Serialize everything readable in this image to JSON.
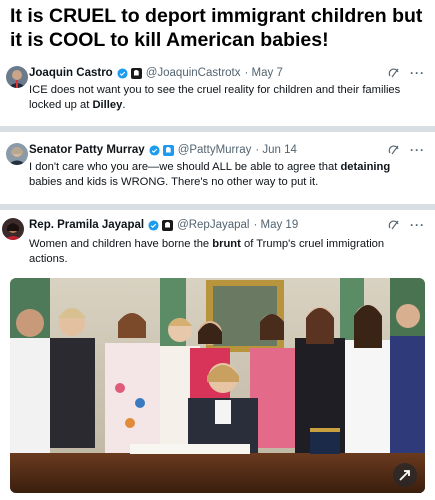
{
  "headline": {
    "line1": "It is CRUEL to deport immigrant children but",
    "line2": "it is COOL to kill American babies!"
  },
  "colors": {
    "verified": "#1d9bf0",
    "separator": "#d9dee2",
    "meta": "#536471"
  },
  "tweets": [
    {
      "name": "Joaquin Castro",
      "handle": "@JoaquinCastrotx",
      "date": "· May 7",
      "text_before": "ICE does not want you to see the cruel reality for children and their families locked up at ",
      "text_bold": "Dilley",
      "text_after": "."
    },
    {
      "name": "Senator Patty Murray",
      "handle": "@PattyMurray",
      "date": "· Jun 14",
      "text_before": "I don't care who you are—we should ALL be able to agree that ",
      "text_bold": "detaining",
      "text_after": " babies and kids is WRONG. There's no other way to put it."
    },
    {
      "name": "Rep. Pramila Jayapal",
      "handle": "@RepJayapal",
      "date": "· May 19",
      "text_before": "Women and children have borne the ",
      "text_bold": "brunt",
      "text_after": " of Trump's cruel immigration actions."
    }
  ],
  "icons": {
    "verified": "verified-badge-icon",
    "gov": "government-badge-icon",
    "grok": "grok-icon",
    "more": "more-icon",
    "repost": "repost-icon"
  },
  "more_label": "···"
}
